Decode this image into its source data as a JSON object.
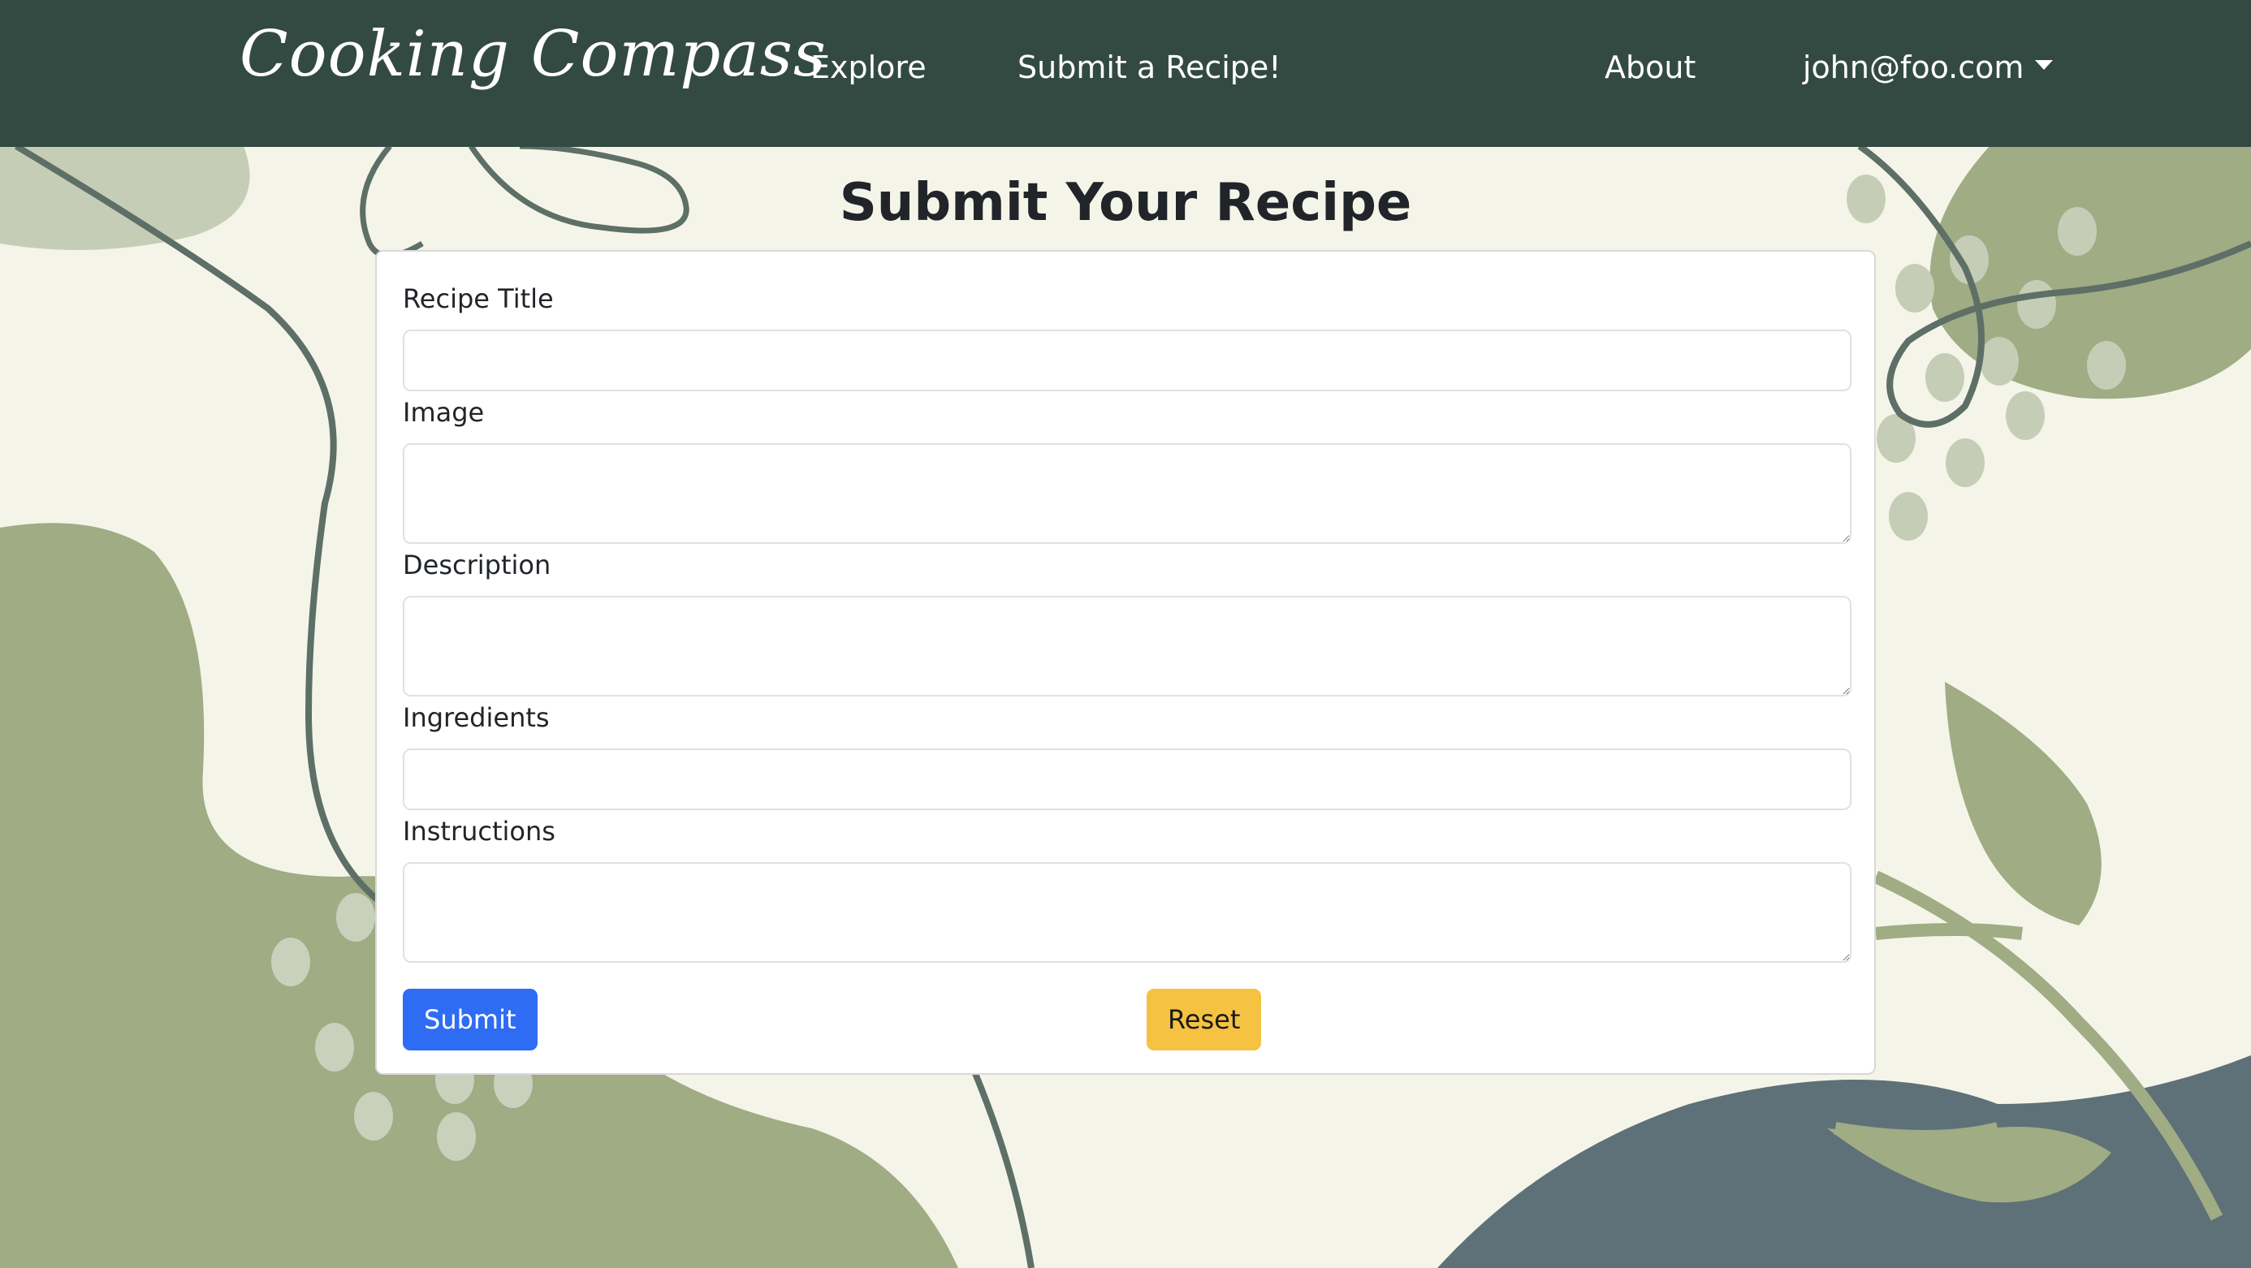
{
  "navbar": {
    "brand": "Cooking Compass",
    "links": {
      "explore": "Explore",
      "submit": "Submit a Recipe!",
      "about": "About"
    },
    "user_email": "john@foo.com"
  },
  "page": {
    "title": "Submit Your Recipe"
  },
  "form": {
    "fields": {
      "title": {
        "label": "Recipe Title",
        "value": ""
      },
      "image": {
        "label": "Image",
        "value": ""
      },
      "description": {
        "label": "Description",
        "value": ""
      },
      "ingredients": {
        "label": "Ingredients",
        "value": ""
      },
      "instructions": {
        "label": "Instructions",
        "value": ""
      }
    },
    "submit_label": "Submit",
    "reset_label": "Reset"
  },
  "colors": {
    "navbar_bg": "#334a42",
    "page_bg": "#f4f5e8",
    "submit_button": "#2f6cf4",
    "reset_button": "#f5c242",
    "sage": "#9fac84",
    "slate": "#5e7078"
  }
}
